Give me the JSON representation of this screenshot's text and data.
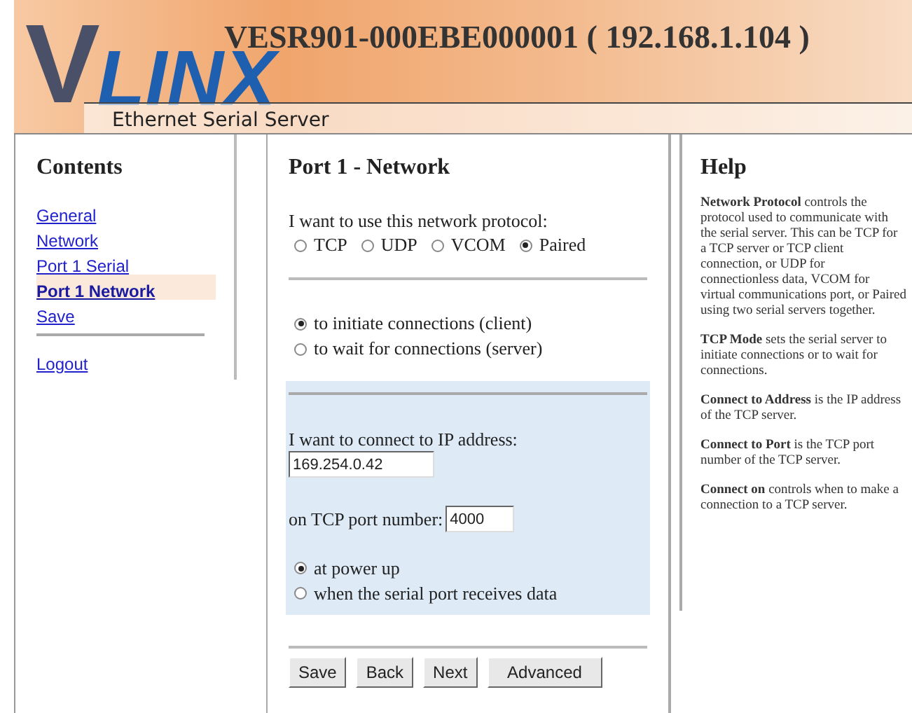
{
  "header": {
    "logo_mark": "V",
    "logo_name": "LINX",
    "tagline": "Ethernet Serial Server",
    "title": "VESR901-000EBE000001 ( 192.168.1.104 )"
  },
  "sidebar": {
    "heading": "Contents",
    "items": [
      {
        "label": "General",
        "selected": false
      },
      {
        "label": "Network",
        "selected": false
      },
      {
        "label": "Port 1 Serial",
        "selected": false
      },
      {
        "label": "Port 1 Network",
        "selected": true
      },
      {
        "label": "Save",
        "selected": false
      }
    ],
    "logout": "Logout"
  },
  "main": {
    "title": "Port 1 - Network",
    "protocol_label": "I want to use this network protocol:",
    "protocols": [
      {
        "label": "TCP",
        "selected": false
      },
      {
        "label": "UDP",
        "selected": false
      },
      {
        "label": "VCOM",
        "selected": false
      },
      {
        "label": "Paired",
        "selected": true
      }
    ],
    "modes": [
      {
        "label": "to initiate connections (client)",
        "selected": true
      },
      {
        "label": "to wait for connections (server)",
        "selected": false
      }
    ],
    "address_label": "I want to connect to IP address:",
    "address_value": "169.254.0.42",
    "port_label": "on TCP port number:",
    "port_value": "4000",
    "connect_options": [
      {
        "label": "at power up",
        "selected": true
      },
      {
        "label": "when the serial port receives data",
        "selected": false
      }
    ],
    "buttons": [
      "Save",
      "Back",
      "Next",
      "Advanced"
    ]
  },
  "help": {
    "heading": "Help",
    "paragraphs": [
      "**Network Protocol** controls the protocol used to communicate with the serial server. This can be TCP for a TCP server or TCP client connection, or UDP for connectionless data, VCOM for virtual communications port, or Paired using two serial servers together.",
      "**TCP Mode** sets the serial server to initiate connections or to wait for connections.",
      "**Connect to Address** is the IP address of the TCP server.",
      "**Connect to Port** is the TCP port number of the TCP server.",
      "**Connect on** controls when to make a connection to a TCP server."
    ]
  }
}
